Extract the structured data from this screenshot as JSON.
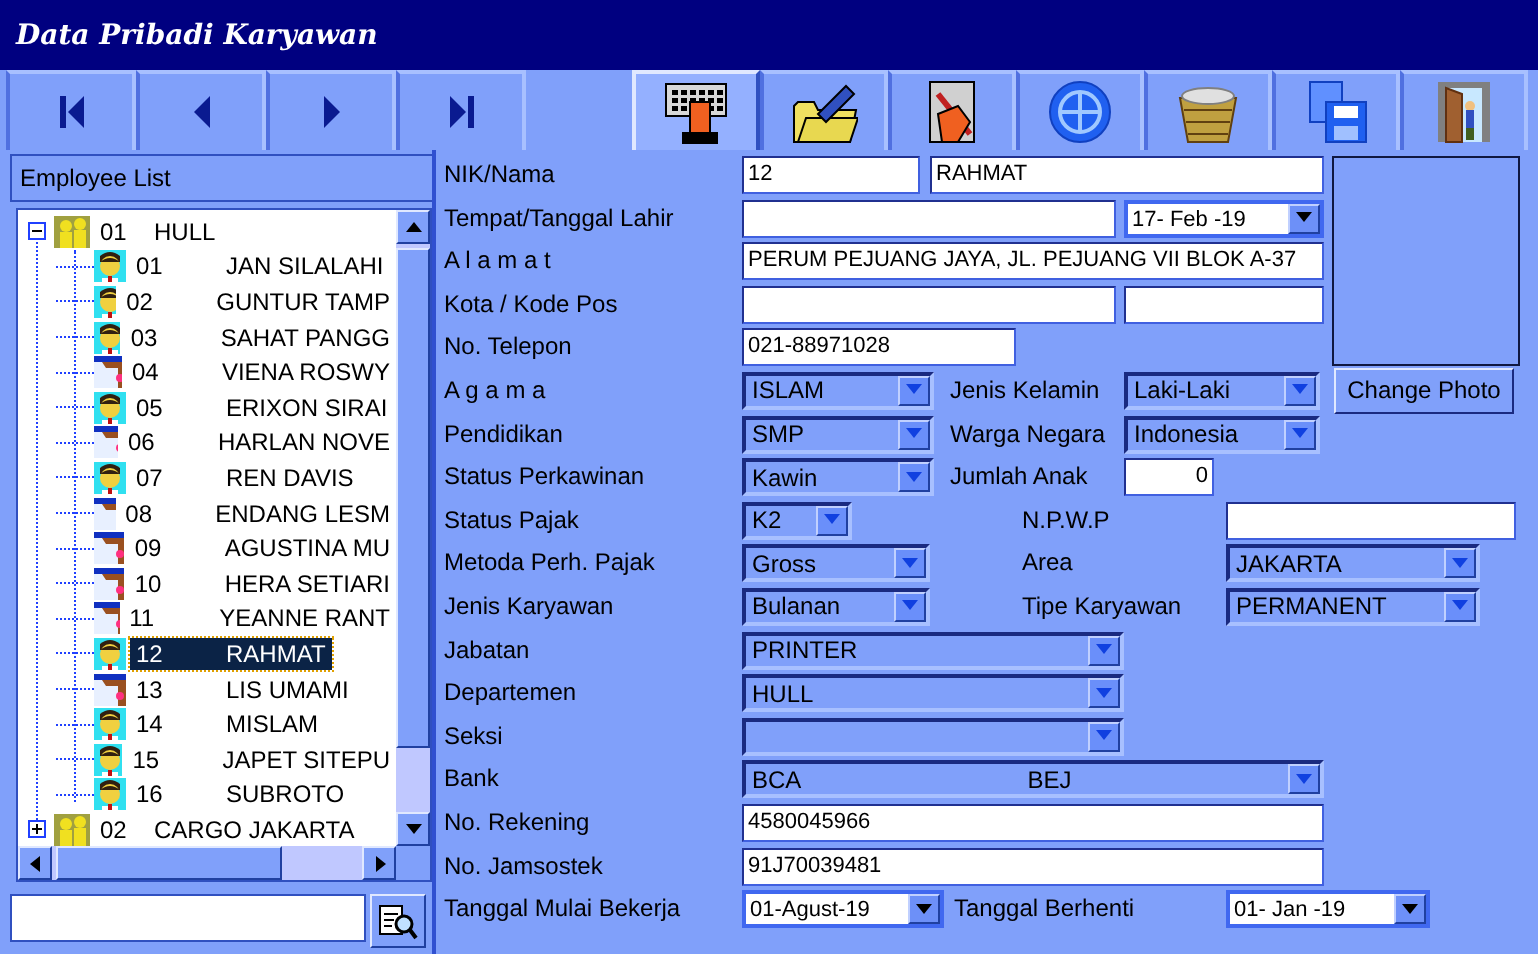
{
  "window": {
    "title": "Data Pribadi Karyawan"
  },
  "toolbar": {
    "nav": [
      {
        "kind": "first"
      },
      {
        "kind": "prev"
      },
      {
        "kind": "next"
      },
      {
        "kind": "last"
      }
    ],
    "actions": [
      {
        "kind": "keyboard",
        "selected": true
      },
      {
        "kind": "folder",
        "selected": false
      },
      {
        "kind": "document",
        "selected": false
      },
      {
        "kind": "globe",
        "selected": false
      },
      {
        "kind": "basket",
        "selected": false
      },
      {
        "kind": "floppy",
        "selected": false
      },
      {
        "kind": "door",
        "selected": false
      }
    ]
  },
  "employee_list": {
    "title": "Employee List",
    "groups": [
      {
        "code": "01",
        "name": "HULL",
        "expanded": true,
        "children": [
          {
            "code": "01",
            "name": "JAN SILALAHI",
            "kind": "male",
            "selected": false
          },
          {
            "code": "02",
            "name": "GUNTUR TAMP",
            "kind": "male",
            "selected": false
          },
          {
            "code": "03",
            "name": "SAHAT PANGG",
            "kind": "male",
            "selected": false
          },
          {
            "code": "04",
            "name": "VIENA ROSWY",
            "kind": "female",
            "selected": false
          },
          {
            "code": "05",
            "name": "ERIXON SIRAI",
            "kind": "male",
            "selected": false
          },
          {
            "code": "06",
            "name": "HARLAN NOVE",
            "kind": "female",
            "selected": false
          },
          {
            "code": "07",
            "name": "REN DAVIS",
            "kind": "male",
            "selected": false
          },
          {
            "code": "08",
            "name": "ENDANG LESM",
            "kind": "female",
            "selected": false
          },
          {
            "code": "09",
            "name": "AGUSTINA MU",
            "kind": "female",
            "selected": false
          },
          {
            "code": "10",
            "name": "HERA SETIARI",
            "kind": "female",
            "selected": false
          },
          {
            "code": "11",
            "name": "YEANNE RANT",
            "kind": "female",
            "selected": false
          },
          {
            "code": "12",
            "name": "RAHMAT",
            "kind": "male",
            "selected": true
          },
          {
            "code": "13",
            "name": "LIS UMAMI",
            "kind": "female",
            "selected": false
          },
          {
            "code": "14",
            "name": "MISLAM",
            "kind": "male",
            "selected": false
          },
          {
            "code": "15",
            "name": "JAPET SITEPU",
            "kind": "male",
            "selected": false
          },
          {
            "code": "16",
            "name": "SUBROTO",
            "kind": "male",
            "selected": false
          }
        ]
      },
      {
        "code": "02",
        "name": "CARGO JAKARTA",
        "expanded": false
      }
    ]
  },
  "form": {
    "rows": [
      {
        "cells": [
          {
            "kind": "label",
            "text": "NIK/Nama"
          },
          {
            "kind": "input",
            "value": "12"
          },
          {
            "kind": "input",
            "value": "RAHMAT"
          },
          {
            "kind": "photo"
          }
        ]
      },
      {
        "cells": [
          {
            "kind": "label",
            "text": "Tempat/Tanggal Lahir"
          },
          {
            "kind": "input"
          },
          {
            "kind": "date",
            "value": "17- Feb -19"
          }
        ]
      },
      {
        "cells": [
          {
            "kind": "label",
            "text": "A l a m a t"
          },
          {
            "kind": "input",
            "value": "PERUM PEJUANG JAYA, JL. PEJUANG VII BLOK A-37"
          }
        ]
      },
      {
        "cells": [
          {
            "kind": "label",
            "text": "Kota / Kode Pos"
          },
          {
            "kind": "input"
          },
          {
            "kind": "input"
          }
        ]
      },
      {
        "cells": [
          {
            "kind": "label",
            "text": "No. Telepon"
          },
          {
            "kind": "input",
            "value": "021-88971028"
          }
        ]
      },
      {
        "cells": [
          {
            "kind": "label",
            "text": "A g a m a"
          },
          {
            "kind": "select",
            "value": "ISLAM"
          },
          {
            "kind": "label",
            "text": "Jenis Kelamin"
          },
          {
            "kind": "select",
            "value": "Laki-Laki"
          },
          {
            "kind": "button",
            "text": "Change Photo"
          }
        ]
      },
      {
        "cells": [
          {
            "kind": "label",
            "text": "Pendidikan"
          },
          {
            "kind": "select",
            "value": "SMP"
          },
          {
            "kind": "label",
            "text": "Warga Negara"
          },
          {
            "kind": "select",
            "value": "Indonesia"
          }
        ]
      },
      {
        "cells": [
          {
            "kind": "label",
            "text": "Status Perkawinan"
          },
          {
            "kind": "select",
            "value": "Kawin"
          },
          {
            "kind": "label",
            "text": "Jumlah Anak"
          },
          {
            "kind": "number",
            "value": "0"
          }
        ]
      },
      {
        "cells": [
          {
            "kind": "label",
            "text": "Status Pajak"
          },
          {
            "kind": "select",
            "value": "K2"
          },
          {
            "kind": "label",
            "text": "N.P.W.P"
          },
          {
            "kind": "input"
          }
        ]
      },
      {
        "cells": [
          {
            "kind": "label",
            "text": "Metoda Perh. Pajak"
          },
          {
            "kind": "select",
            "value": "Gross"
          },
          {
            "kind": "label",
            "text": "Area"
          },
          {
            "kind": "select",
            "value": "JAKARTA"
          }
        ]
      },
      {
        "cells": [
          {
            "kind": "label",
            "text": "Jenis Karyawan"
          },
          {
            "kind": "select",
            "value": "Bulanan"
          },
          {
            "kind": "label",
            "text": "Tipe Karyawan"
          },
          {
            "kind": "select",
            "value": "PERMANENT"
          }
        ]
      },
      {
        "cells": [
          {
            "kind": "label",
            "text": "Jabatan"
          },
          {
            "kind": "select",
            "value": "PRINTER"
          }
        ]
      },
      {
        "cells": [
          {
            "kind": "label",
            "text": "Departemen"
          },
          {
            "kind": "select",
            "value": "HULL"
          }
        ]
      },
      {
        "cells": [
          {
            "kind": "label",
            "text": "Seksi"
          },
          {
            "kind": "select"
          }
        ]
      },
      {
        "cells": [
          {
            "kind": "label",
            "text": "Bank"
          },
          {
            "kind": "select",
            "value": "BCA",
            "secondary": "BEJ"
          }
        ]
      },
      {
        "cells": [
          {
            "kind": "label",
            "text": "No. Rekening"
          },
          {
            "kind": "input",
            "value": "4580045966"
          }
        ]
      },
      {
        "cells": [
          {
            "kind": "label",
            "text": "No. Jamsostek"
          },
          {
            "kind": "input",
            "value": "91J70039481"
          }
        ]
      },
      {
        "cells": [
          {
            "kind": "label",
            "text": "Tanggal Mulai Bekerja"
          },
          {
            "kind": "date",
            "value": "01-Agust-19"
          },
          {
            "kind": "label",
            "text": "Tanggal Berhenti"
          },
          {
            "kind": "date",
            "value": "01- Jan -19"
          }
        ]
      }
    ]
  }
}
